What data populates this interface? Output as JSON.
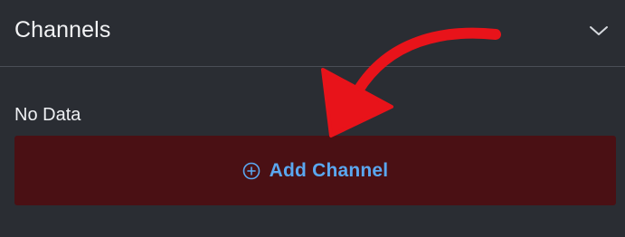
{
  "panel": {
    "title": "Channels",
    "collapse_icon": "chevron-down-icon"
  },
  "content": {
    "empty_text": "No Data",
    "add_button": {
      "label": "Add Channel",
      "icon": "plus-circle-icon"
    }
  },
  "colors": {
    "background": "#2a2d33",
    "button_background": "#4a1014",
    "button_text": "#5aa7f0",
    "annotation_arrow": "#e8131a"
  }
}
